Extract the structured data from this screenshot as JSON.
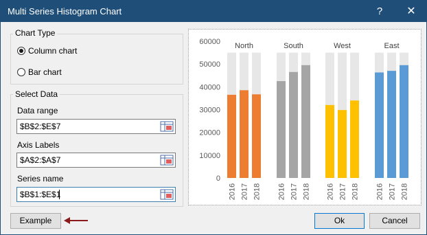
{
  "window": {
    "title": "Multi Series Histogram Chart"
  },
  "titlebar": {
    "help_label": "?",
    "close_label": "✕"
  },
  "chart_type": {
    "group_label": "Chart Type",
    "options": [
      {
        "label": "Column chart",
        "selected": true
      },
      {
        "label": "Bar chart",
        "selected": false
      }
    ]
  },
  "select_data": {
    "group_label": "Select Data",
    "data_range": {
      "label": "Data range",
      "value": "$B$2:$E$7"
    },
    "axis_labels": {
      "label": "Axis Labels",
      "value": "$A$2:$A$7"
    },
    "series_name": {
      "label": "Series name",
      "value": "$B$1:$E$1"
    }
  },
  "buttons": {
    "example": "Example",
    "ok": "Ok",
    "cancel": "Cancel"
  },
  "icons": {
    "range_select": "range-select-icon",
    "arrow": "left-arrow-icon"
  },
  "colors": {
    "title_bar": "#1f4e79",
    "North": "#ed7d31",
    "South": "#a5a5a5",
    "West": "#ffc000",
    "East": "#5b9bd5",
    "background_bar": "#e7e7e7",
    "arrow": "#8b1a1a"
  },
  "chart_data": {
    "type": "bar",
    "ylim": [
      0,
      60000
    ],
    "yticks": [
      0,
      10000,
      20000,
      30000,
      40000,
      50000,
      60000
    ],
    "ytick_labels": [
      "0",
      "10000",
      "20000",
      "30000",
      "40000",
      "50000",
      "60000"
    ],
    "background_value": 55000,
    "groups": [
      {
        "name": "North",
        "categories": [
          "2016",
          "2017",
          "2018"
        ],
        "values": [
          36500,
          38500,
          36700
        ]
      },
      {
        "name": "South",
        "categories": [
          "2016",
          "2017",
          "2018"
        ],
        "values": [
          42500,
          46500,
          49500
        ]
      },
      {
        "name": "West",
        "categories": [
          "2016",
          "2017",
          "2018"
        ],
        "values": [
          32000,
          29800,
          34000
        ]
      },
      {
        "name": "East",
        "categories": [
          "2016",
          "2017",
          "2018"
        ],
        "values": [
          46300,
          47000,
          49500
        ]
      }
    ],
    "grid": false,
    "legend": "none"
  }
}
